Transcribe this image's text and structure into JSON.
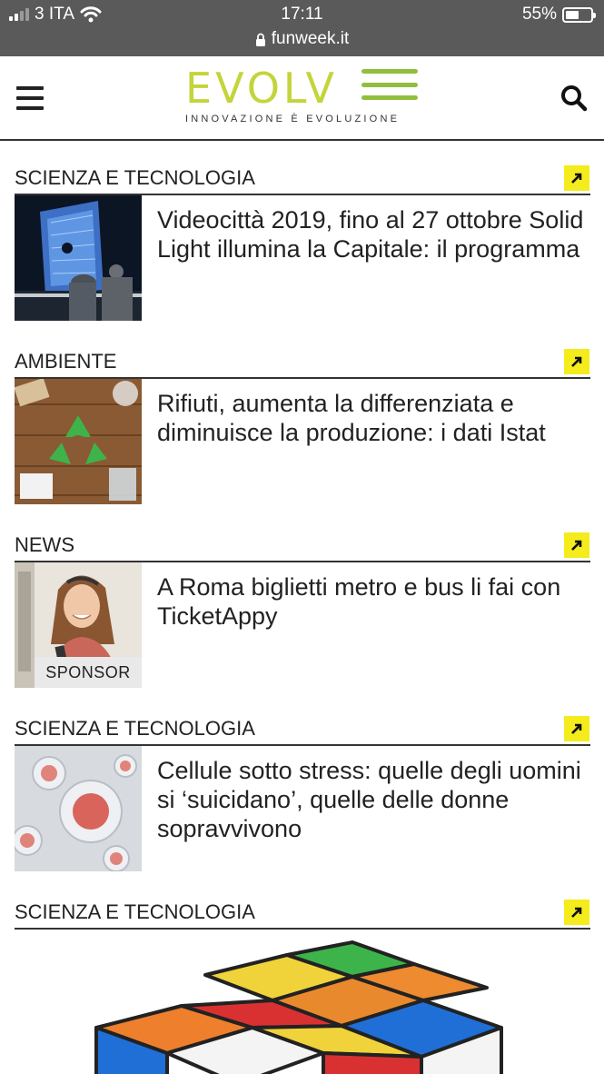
{
  "status_bar": {
    "carrier": "3 ITA",
    "time": "17:11",
    "battery": "55%",
    "battery_level": 0.55,
    "url": "funweek.it"
  },
  "header": {
    "logo_text": "EVOLV",
    "tagline": "INNOVAZIONE È EVOLUZIONE"
  },
  "articles": [
    {
      "category": "SCIENZA E TECNOLOGIA",
      "title": "Videocittà 2019, fino al 27 ottobre Solid Light illumina la Capitale: il programma"
    },
    {
      "category": "AMBIENTE",
      "title": "Rifiuti, aumenta la differenziata e diminuisce la produzione: i dati Istat"
    },
    {
      "category": "NEWS",
      "title": "A Roma biglietti metro e bus li fai con TicketAppy",
      "badge": "SPONSOR"
    },
    {
      "category": "SCIENZA E TECNOLOGIA",
      "title": "Cellule sotto stress: quelle degli uomini si ‘suicidano’, quelle delle donne sopravvivono"
    },
    {
      "category": "SCIENZA E TECNOLOGIA"
    }
  ],
  "colors": {
    "status_bg": "#5a5a5a",
    "logo_green": "#c4d43a",
    "arrow_yellow": "#f4ec1c"
  }
}
